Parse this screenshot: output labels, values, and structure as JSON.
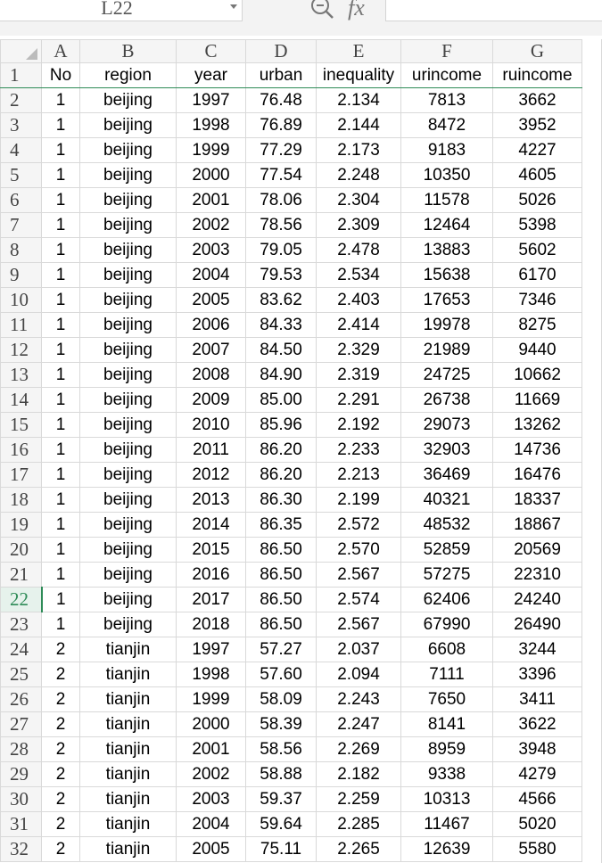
{
  "name_box": "L22",
  "fx_label": "fx",
  "col_letters": [
    "A",
    "B",
    "C",
    "D",
    "E",
    "F",
    "G"
  ],
  "rows": [
    {
      "n": "1",
      "cells": [
        "No",
        "region",
        "year",
        "urban",
        "inequality",
        "urincome",
        "ruincome"
      ]
    },
    {
      "n": "2",
      "cells": [
        "1",
        "beijing",
        "1997",
        "76.48",
        "2.134",
        "7813",
        "3662"
      ]
    },
    {
      "n": "3",
      "cells": [
        "1",
        "beijing",
        "1998",
        "76.89",
        "2.144",
        "8472",
        "3952"
      ]
    },
    {
      "n": "4",
      "cells": [
        "1",
        "beijing",
        "1999",
        "77.29",
        "2.173",
        "9183",
        "4227"
      ]
    },
    {
      "n": "5",
      "cells": [
        "1",
        "beijing",
        "2000",
        "77.54",
        "2.248",
        "10350",
        "4605"
      ]
    },
    {
      "n": "6",
      "cells": [
        "1",
        "beijing",
        "2001",
        "78.06",
        "2.304",
        "11578",
        "5026"
      ]
    },
    {
      "n": "7",
      "cells": [
        "1",
        "beijing",
        "2002",
        "78.56",
        "2.309",
        "12464",
        "5398"
      ]
    },
    {
      "n": "8",
      "cells": [
        "1",
        "beijing",
        "2003",
        "79.05",
        "2.478",
        "13883",
        "5602"
      ]
    },
    {
      "n": "9",
      "cells": [
        "1",
        "beijing",
        "2004",
        "79.53",
        "2.534",
        "15638",
        "6170"
      ]
    },
    {
      "n": "10",
      "cells": [
        "1",
        "beijing",
        "2005",
        "83.62",
        "2.403",
        "17653",
        "7346"
      ]
    },
    {
      "n": "11",
      "cells": [
        "1",
        "beijing",
        "2006",
        "84.33",
        "2.414",
        "19978",
        "8275"
      ]
    },
    {
      "n": "12",
      "cells": [
        "1",
        "beijing",
        "2007",
        "84.50",
        "2.329",
        "21989",
        "9440"
      ]
    },
    {
      "n": "13",
      "cells": [
        "1",
        "beijing",
        "2008",
        "84.90",
        "2.319",
        "24725",
        "10662"
      ]
    },
    {
      "n": "14",
      "cells": [
        "1",
        "beijing",
        "2009",
        "85.00",
        "2.291",
        "26738",
        "11669"
      ]
    },
    {
      "n": "15",
      "cells": [
        "1",
        "beijing",
        "2010",
        "85.96",
        "2.192",
        "29073",
        "13262"
      ]
    },
    {
      "n": "16",
      "cells": [
        "1",
        "beijing",
        "2011",
        "86.20",
        "2.233",
        "32903",
        "14736"
      ]
    },
    {
      "n": "17",
      "cells": [
        "1",
        "beijing",
        "2012",
        "86.20",
        "2.213",
        "36469",
        "16476"
      ]
    },
    {
      "n": "18",
      "cells": [
        "1",
        "beijing",
        "2013",
        "86.30",
        "2.199",
        "40321",
        "18337"
      ]
    },
    {
      "n": "19",
      "cells": [
        "1",
        "beijing",
        "2014",
        "86.35",
        "2.572",
        "48532",
        "18867"
      ]
    },
    {
      "n": "20",
      "cells": [
        "1",
        "beijing",
        "2015",
        "86.50",
        "2.570",
        "52859",
        "20569"
      ]
    },
    {
      "n": "21",
      "cells": [
        "1",
        "beijing",
        "2016",
        "86.50",
        "2.567",
        "57275",
        "22310"
      ]
    },
    {
      "n": "22",
      "cells": [
        "1",
        "beijing",
        "2017",
        "86.50",
        "2.574",
        "62406",
        "24240"
      ]
    },
    {
      "n": "23",
      "cells": [
        "1",
        "beijing",
        "2018",
        "86.50",
        "2.567",
        "67990",
        "26490"
      ]
    },
    {
      "n": "24",
      "cells": [
        "2",
        "tianjin",
        "1997",
        "57.27",
        "2.037",
        "6608",
        "3244"
      ]
    },
    {
      "n": "25",
      "cells": [
        "2",
        "tianjin",
        "1998",
        "57.60",
        "2.094",
        "7111",
        "3396"
      ]
    },
    {
      "n": "26",
      "cells": [
        "2",
        "tianjin",
        "1999",
        "58.09",
        "2.243",
        "7650",
        "3411"
      ]
    },
    {
      "n": "27",
      "cells": [
        "2",
        "tianjin",
        "2000",
        "58.39",
        "2.247",
        "8141",
        "3622"
      ]
    },
    {
      "n": "28",
      "cells": [
        "2",
        "tianjin",
        "2001",
        "58.56",
        "2.269",
        "8959",
        "3948"
      ]
    },
    {
      "n": "29",
      "cells": [
        "2",
        "tianjin",
        "2002",
        "58.88",
        "2.182",
        "9338",
        "4279"
      ]
    },
    {
      "n": "30",
      "cells": [
        "2",
        "tianjin",
        "2003",
        "59.37",
        "2.259",
        "10313",
        "4566"
      ]
    },
    {
      "n": "31",
      "cells": [
        "2",
        "tianjin",
        "2004",
        "59.64",
        "2.285",
        "11467",
        "5020"
      ]
    },
    {
      "n": "32",
      "cells": [
        "2",
        "tianjin",
        "2005",
        "75.11",
        "2.265",
        "12639",
        "5580"
      ]
    }
  ],
  "active_row": "22",
  "accent_color": "#2e8b57"
}
